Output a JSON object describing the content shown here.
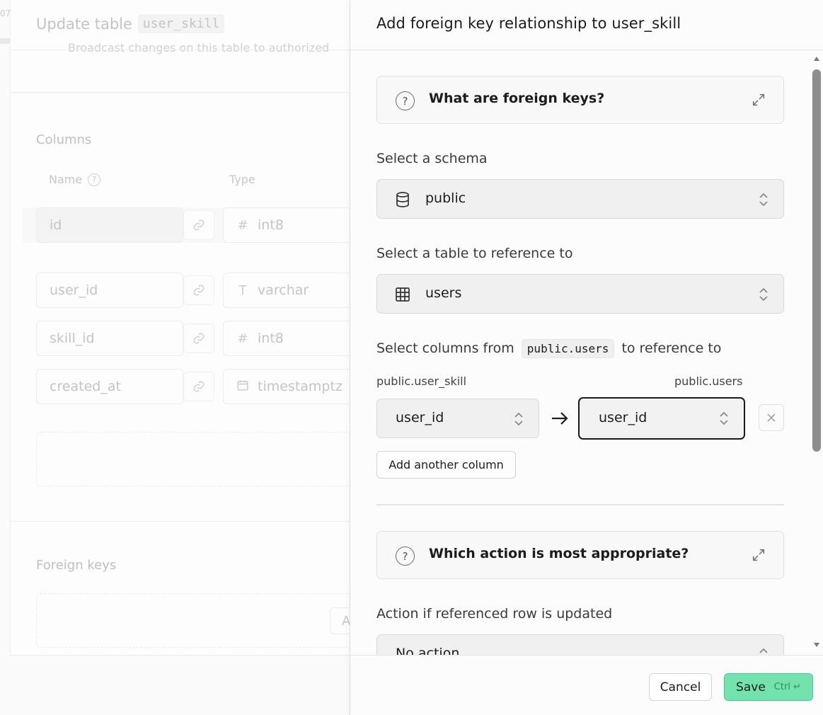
{
  "background": {
    "fragment": "07",
    "title_prefix": "Update table",
    "table_name": "user_skill",
    "subtitle": "Broadcast changes on this table to authorized",
    "columns_heading": "Columns",
    "header_name": "Name",
    "header_type": "Type",
    "rows": [
      {
        "name": "id",
        "type": "int8",
        "type_icon": "#"
      },
      {
        "name": "user_id",
        "type": "varchar",
        "type_icon": "T"
      },
      {
        "name": "skill_id",
        "type": "int8",
        "type_icon": "#"
      },
      {
        "name": "created_at",
        "type": "timestamptz",
        "type_icon": "calendar-icon"
      }
    ],
    "foreign_keys_heading": "Foreign keys",
    "fk_button_fragment": "A"
  },
  "sheet": {
    "title": "Add foreign key relationship to user_skill",
    "info_foreign_keys": "What are foreign keys?",
    "schema_label": "Select a schema",
    "schema_value": "public",
    "table_label": "Select a table to reference to",
    "table_value": "users",
    "columns_label_pre": "Select columns from",
    "columns_label_code": "public.users",
    "columns_label_post": "to reference to",
    "source_table": "public.user_skill",
    "target_table": "public.users",
    "source_column": "user_id",
    "target_column": "user_id",
    "add_column_label": "Add another column",
    "info_action": "Which action is most appropriate?",
    "on_update_label": "Action if referenced row is updated",
    "on_update_value": "No action"
  },
  "footer": {
    "cancel_label": "Cancel",
    "save_label": "Save",
    "save_shortcut": "Ctrl ↵"
  },
  "colors": {
    "accent": "#72e3ad",
    "accent_border": "#3ecf8e"
  }
}
